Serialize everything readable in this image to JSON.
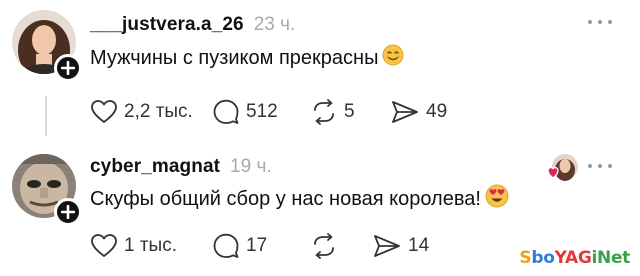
{
  "posts": [
    {
      "username": "___justvera.a_26",
      "time": "23 ч.",
      "text": "Мужчины с пузиком прекрасны",
      "emoji_icon": "smiling-face-emoji",
      "likes": "2,2 тыс.",
      "replies": "512",
      "reposts": "5",
      "shares": "49"
    },
    {
      "username": "cyber_magnat",
      "time": "19 ч.",
      "text": "Скуфы общий сбор у нас новая королева!",
      "emoji_icon": "heart-eyes-emoji",
      "likes": "1 тыс.",
      "replies": "17",
      "reposts": "",
      "shares": "14"
    }
  ],
  "watermark": "SboYAGiNet",
  "colors": {
    "text": "#111111",
    "muted": "#a9a9a9",
    "icon": "#333333",
    "badge": "#111111",
    "heart": "#e0245e"
  }
}
